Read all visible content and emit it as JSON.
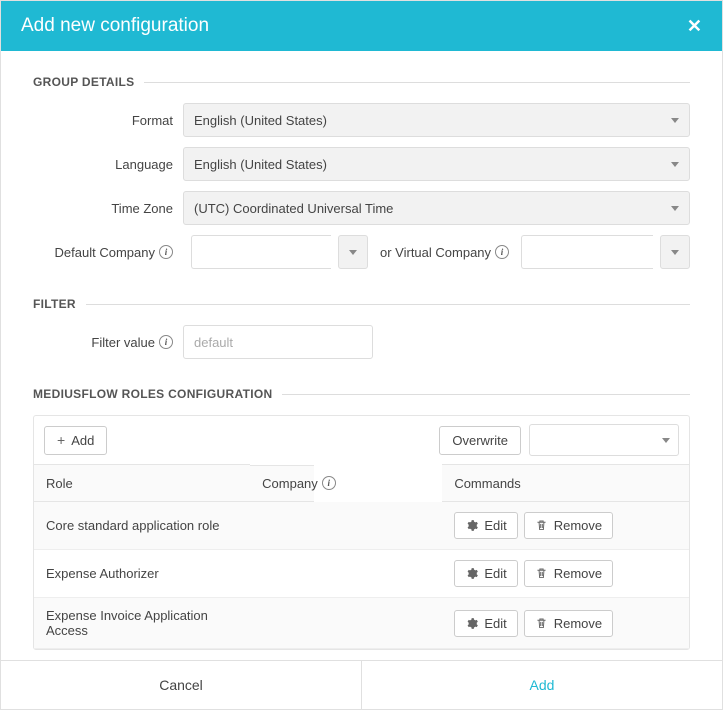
{
  "header": {
    "title": "Add new configuration"
  },
  "sections": {
    "group_details": "GROUP DETAILS",
    "filter": "FILTER",
    "roles": "MEDIUSFLOW ROLES CONFIGURATION"
  },
  "labels": {
    "format": "Format",
    "language": "Language",
    "time_zone": "Time Zone",
    "default_company": "Default Company",
    "virtual_company": "or Virtual Company",
    "filter_value": "Filter value"
  },
  "values": {
    "format": "English (United States)",
    "language": "English (United States)",
    "time_zone": "(UTC) Coordinated Universal Time",
    "default_company": "",
    "virtual_company": "",
    "filter_placeholder": "default",
    "overwrite_selected": ""
  },
  "roles_toolbar": {
    "add": "Add",
    "overwrite": "Overwrite"
  },
  "table": {
    "columns": {
      "role": "Role",
      "company": "Company",
      "commands": "Commands"
    },
    "edit_label": "Edit",
    "remove_label": "Remove",
    "rows": [
      {
        "role": "Core standard application role",
        "company": ""
      },
      {
        "role": "Expense Authorizer",
        "company": ""
      },
      {
        "role": "Expense Invoice Application Access",
        "company": ""
      }
    ]
  },
  "footer": {
    "cancel": "Cancel",
    "add": "Add"
  }
}
